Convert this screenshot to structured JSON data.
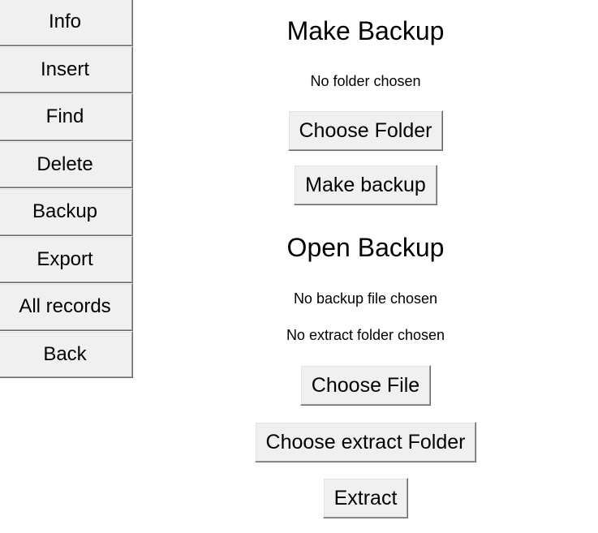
{
  "sidebar": {
    "items": [
      {
        "label": "Info"
      },
      {
        "label": "Insert"
      },
      {
        "label": "Find"
      },
      {
        "label": "Delete"
      },
      {
        "label": "Backup"
      },
      {
        "label": "Export"
      },
      {
        "label": "All records"
      },
      {
        "label": "Back"
      }
    ]
  },
  "make_backup": {
    "title": "Make Backup",
    "folder_status": "No folder chosen",
    "choose_folder_label": "Choose Folder",
    "make_backup_label": "Make backup"
  },
  "open_backup": {
    "title": "Open Backup",
    "file_status": "No backup file chosen",
    "extract_folder_status": "No extract folder chosen",
    "choose_file_label": "Choose File",
    "choose_extract_folder_label": "Choose extract Folder",
    "extract_label": "Extract"
  },
  "colors": {
    "button_face": "#f0f0f0",
    "button_border": "#a0a0a0",
    "background": "#ffffff",
    "text": "#000000"
  }
}
